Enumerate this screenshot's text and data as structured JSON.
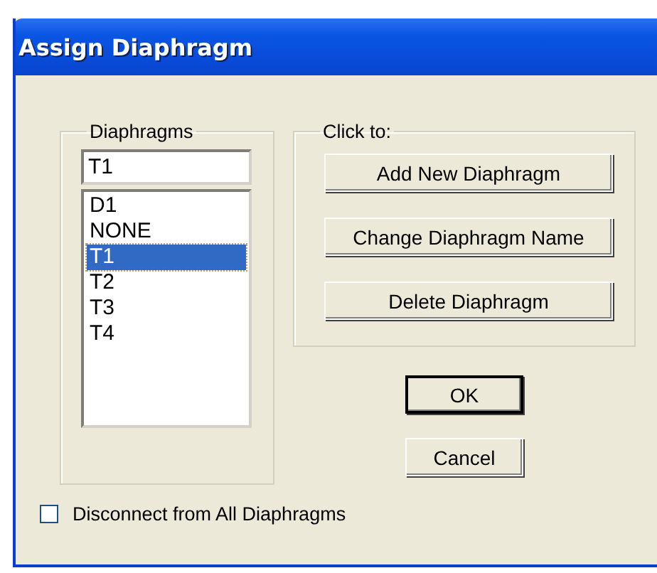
{
  "window": {
    "title": "Assign Diaphragm"
  },
  "diaphragms": {
    "legend": "Diaphragms",
    "value": "T1",
    "items": [
      {
        "label": "D1",
        "selected": false
      },
      {
        "label": "NONE",
        "selected": false
      },
      {
        "label": "T1",
        "selected": true
      },
      {
        "label": "T2",
        "selected": false
      },
      {
        "label": "T3",
        "selected": false
      },
      {
        "label": "T4",
        "selected": false
      }
    ]
  },
  "actions": {
    "legend": "Click to:",
    "buttons": [
      "Add New Diaphragm",
      "Change Diaphragm Name",
      "Delete Diaphragm"
    ]
  },
  "dialog_buttons": [
    {
      "label": "OK",
      "default": true
    },
    {
      "label": "Cancel",
      "default": false
    }
  ],
  "disconnect": {
    "label": "Disconnect from All Diaphragms",
    "checked": false
  }
}
